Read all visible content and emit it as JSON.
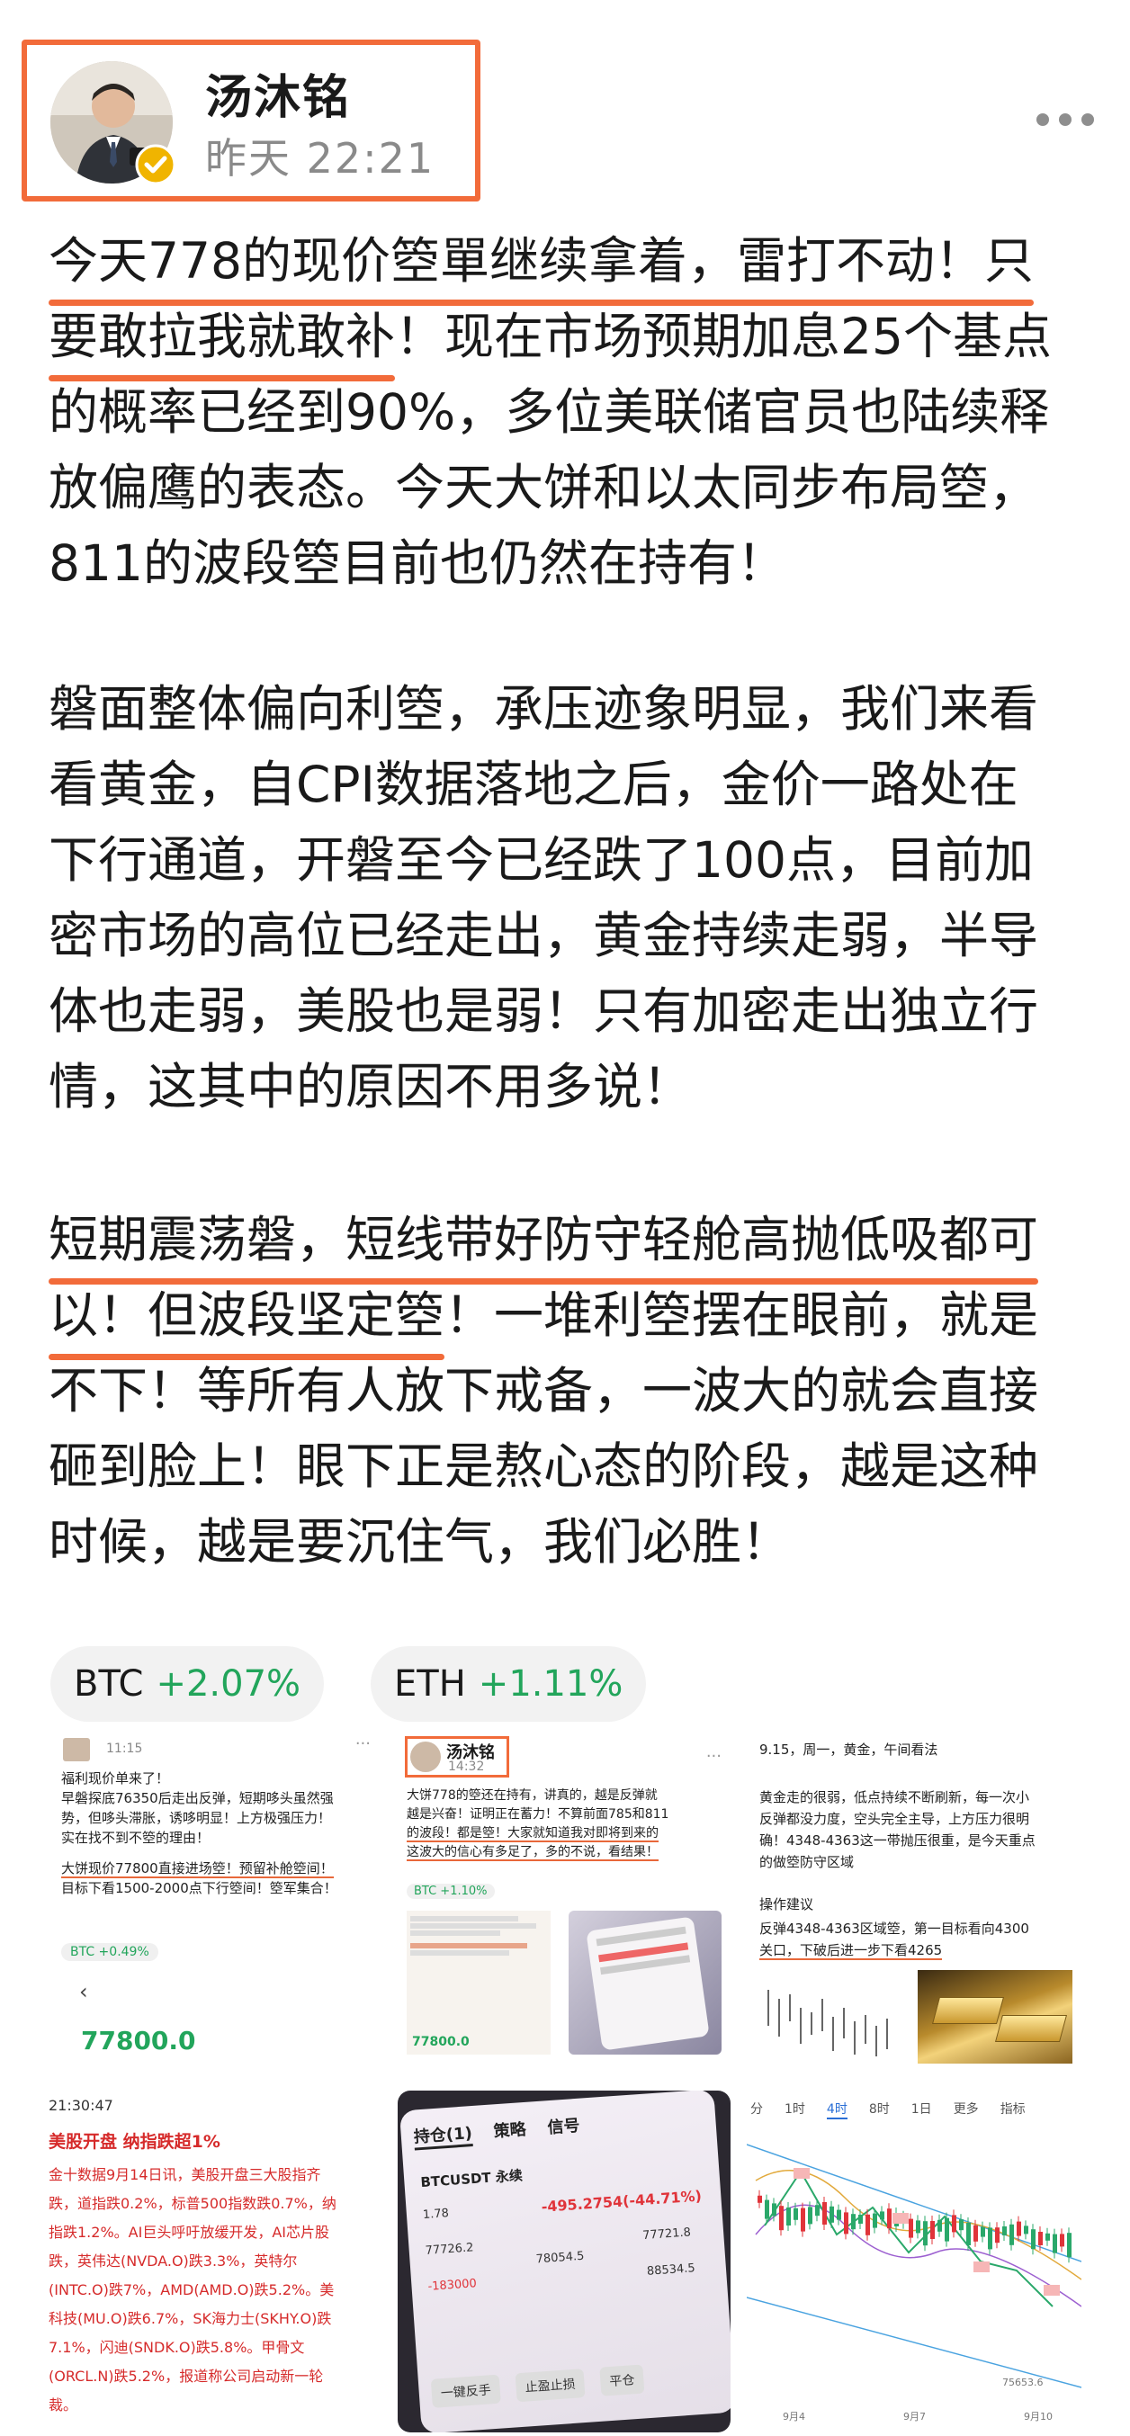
{
  "author": {
    "name": "汤沐铭",
    "time": "昨天 22:21"
  },
  "post": {
    "p1": [
      "今天778的现价箜單继续拿着，雷打不动！只",
      "要敢拉我就敢补",
      "！现在市场预期加息25个基点",
      "的概率已经到90%，多位美联储官员也陆续释",
      "放偏鹰的表态。今天大饼和以太同步布局箜，",
      "811的波段箜目前也仍然在持有！"
    ],
    "p2": [
      "磐面整体偏向利箜，承压迹象明显，我们来看",
      "看黄金，自CPI数据落地之后，金价一路处在",
      "下行通道，开磐至今已经跌了100点，目前加",
      "密市场的高位已经走出，黄金持续走弱，半导",
      "体也走弱，美股也是弱！只有加密走出独立行",
      "情，这其中的原因不用多说！"
    ],
    "p3": [
      "短期震荡磐，短线带好防守轻舱高抛低吸都可",
      "以！但波段坚定箜",
      "！一堆利箜摆在眼前，就是",
      "不下！等所有人放下戒备，一波大的就会直接",
      "砸到脸上！眼下正是熬心态的阶段，越是这种",
      "时候，越是要沉住气，我们必胜！"
    ]
  },
  "tickers": [
    {
      "symbol": "BTC",
      "change": "+2.07%"
    },
    {
      "symbol": "ETH",
      "change": "+1.11%"
    }
  ],
  "colors": {
    "accent": "#f26b3a",
    "up": "#22a55b",
    "muted": "#8a8a8a"
  },
  "thumbs": {
    "t1": {
      "time": "11:15",
      "lines": [
        "福利现价单来了！",
        "早磐探底76350后走出反弹，短期哆头虽然强",
        "势，但哆头滞胀，诱哆明显！上方极强压力！",
        "实在找不到不箜的理由！",
        "大饼现价77800直接进场箜！预留补舱箜间！",
        "目标下看1500-2000点下行箜间！箜军集合！"
      ],
      "btc": "BTC +0.49%",
      "price": "77800.0"
    },
    "t2": {
      "name": "汤沐铭",
      "time": "14:32",
      "lines": [
        "大饼778的箜还在持有，讲真的，越是反弹就",
        "越是兴奋！证明正在蓄力！不算前面785和811",
        "的波段！都是箜！大家就知道我对即将到来的",
        "这波大的信心有多足了，多的不说，看结果！"
      ],
      "btc": "BTC +1.10%",
      "price": "77800.0"
    },
    "t3": {
      "title": "9.15，周一，黄金，午间看法",
      "lines": [
        "黄金走的很弱，低点持续不断刷新，每一次小",
        "反弹都没力度，空头完全主导，上方压力很明",
        "确！4348-4363这一带抛压很重，是今天重点",
        "的做箜防守区域"
      ],
      "op_title": "操作建议",
      "op_lines": [
        "反弹4348-4363区域箜，第一目标看向4300",
        "关口，下破后进一步下看4265"
      ]
    },
    "t4": {
      "time": "21:30:47",
      "headline": "美股开盘 纳指跌超1%",
      "lines": [
        "金十数据9月14日讯，美股开盘三大股指齐",
        "跌，道指跌0.2%，标普500指数跌0.7%，纳",
        "指跌1.2%。AI巨头呼吁放缓开发，AI芯片股",
        "跌，英伟达(NVDA.O)跌3.3%，英特尔",
        "(INTC.O)跌7%，AMD(AMD.O)跌5.2%。美",
        "科技(MU.O)跌6.7%，SK海力士(SKHY.O)跌",
        "7.1%，闪迪(SNDK.O)跌5.8%。甲骨文",
        "(ORCL.N)跌5.2%，报道称公司启动新一轮",
        "裁。"
      ]
    },
    "t5": {
      "tabs": [
        "持仓(1)",
        "策略",
        "信号"
      ],
      "pair": "BTCUSDT 永续",
      "pnl": "-495.2754(-44.71%)",
      "v1": "1.78",
      "v2": "77726.2",
      "v3": "78054.5",
      "v4": "77721.8",
      "v5": "88534.5",
      "v6": "-183000",
      "btns": [
        "一键反手",
        "止盈止损",
        "平仓"
      ]
    },
    "t6": {
      "tabs": [
        "分",
        "1时",
        "4时",
        "8时",
        "1日",
        "更多",
        "指标"
      ],
      "dates": [
        "9月4",
        "9月7",
        "9月10"
      ],
      "level": "75653.6"
    }
  }
}
